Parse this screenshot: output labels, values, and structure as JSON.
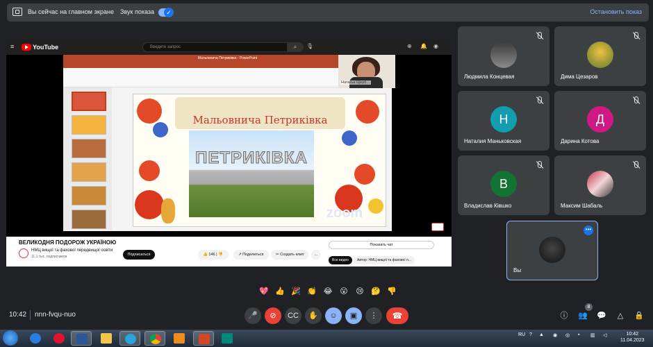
{
  "banner": {
    "presenting_text": "Вы сейчас на главном экране",
    "sound_text": "Звук показа",
    "stop_label": "Остановить показ"
  },
  "youtube": {
    "logo_text": "YouTube",
    "search_placeholder": "Введите запрос",
    "video_title": "ВЕЛИКОДНЯ ПОДОРОЖ УКРАЇНОЮ",
    "channel_name": "НМЦ вищої та фахової передвищої освіти",
    "channel_subs": "11,1 тыс. подписчиков",
    "subscribe_label": "Подписаться",
    "likes": "146",
    "share_label": "Поделиться",
    "clip_label": "Создать клип",
    "show_chat_label": "Показать чат",
    "chip_all": "Все видео",
    "chip_author": "Автор: НМЦ вищої та фахової п..."
  },
  "ppt": {
    "window_title": "Мальовнича Петриківка - PowerPoint",
    "slide_title": "Мальовнича Петриківка",
    "photo_word": "ПЕТРИКІВКА",
    "watermark": "zoom",
    "presenter_name": "Натаља Щерб..."
  },
  "participants": [
    {
      "name": "Людмила Концевая",
      "initial": "",
      "color": "#6b6b6b"
    },
    {
      "name": "Дима Цезаров",
      "initial": "",
      "color": "#6f8f3f"
    },
    {
      "name": "Наталия Маньковская",
      "initial": "Н",
      "color": "#129eaf"
    },
    {
      "name": "Дарина Котова",
      "initial": "Д",
      "color": "#d01884"
    },
    {
      "name": "Владислав Кiвшко",
      "initial": "В",
      "color": "#137333"
    },
    {
      "name": "Максим Шабаль",
      "initial": "",
      "color": "#c6374a"
    }
  ],
  "self": {
    "name": "Вы"
  },
  "reactions": [
    "💖",
    "👍",
    "🎉",
    "👏",
    "😂",
    "😮",
    "😢",
    "🤔",
    "👎"
  ],
  "bottom": {
    "time": "10:42",
    "meeting_code": "nnn-fvqu-nuo",
    "participants_count": "8"
  },
  "taskbar": {
    "lang": "RU",
    "clock_time": "10:42",
    "clock_date": "11.04.2023"
  }
}
